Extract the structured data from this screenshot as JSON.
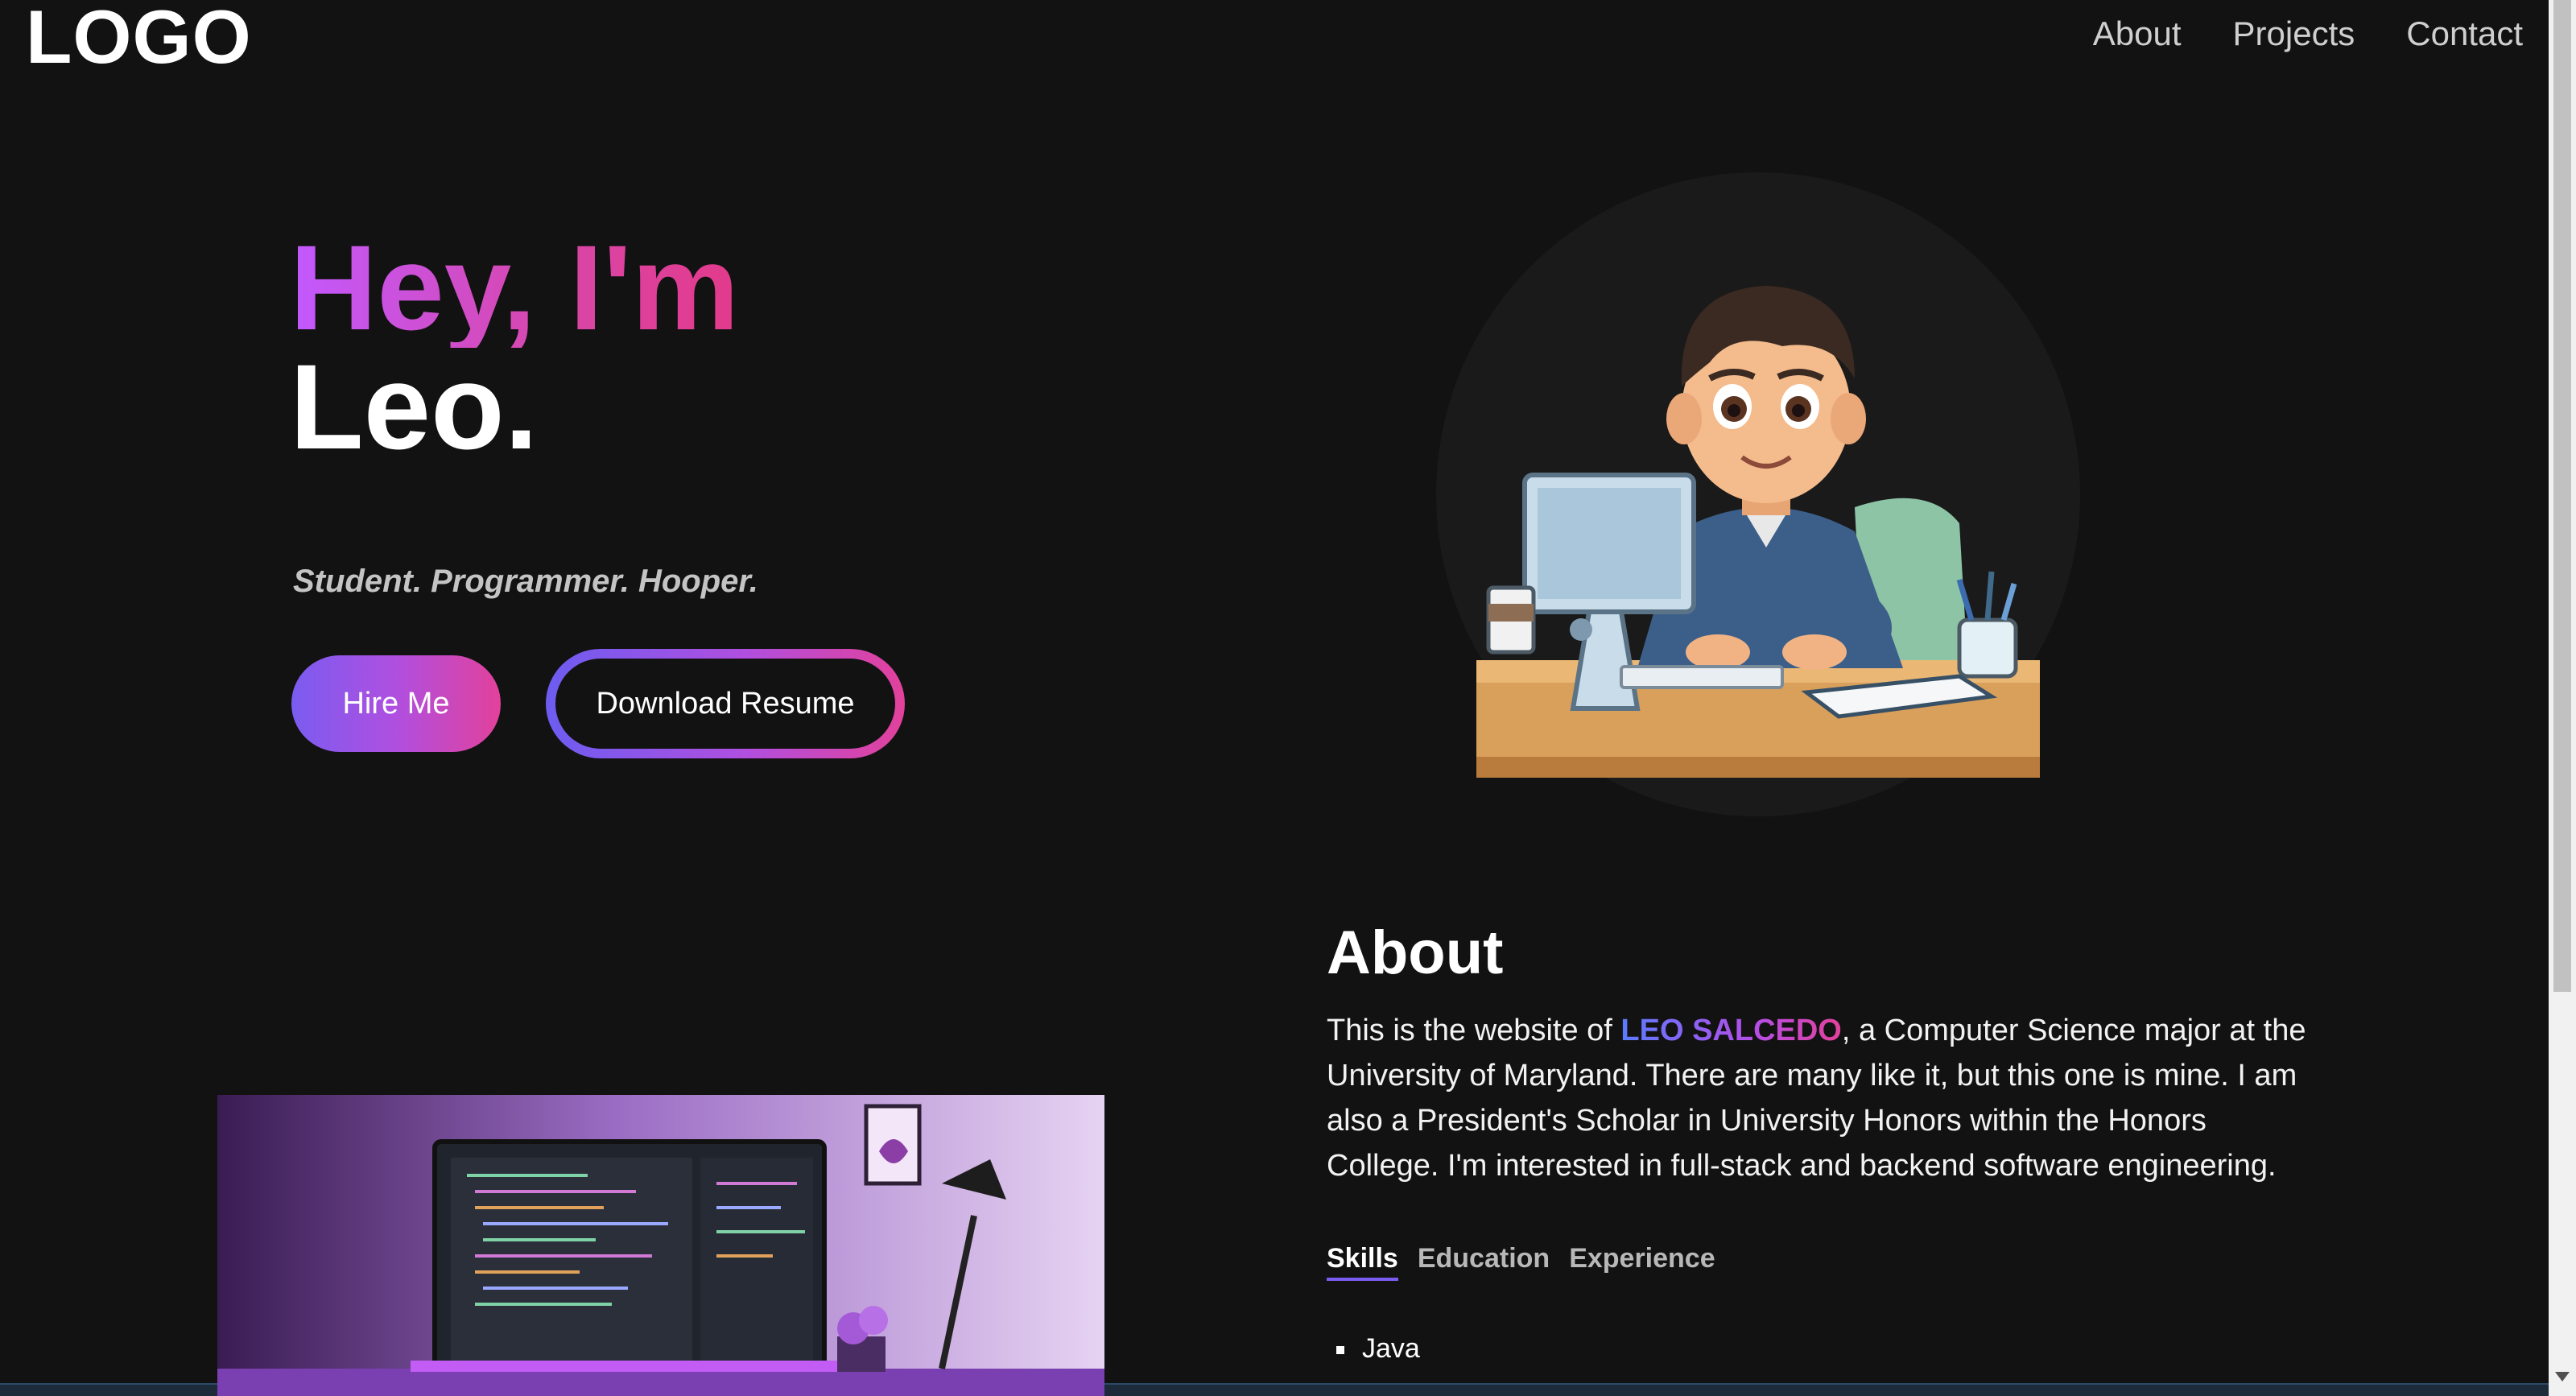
{
  "header": {
    "logo": "LOGO",
    "nav": [
      "About",
      "Projects",
      "Contact"
    ]
  },
  "hero": {
    "greeting": "Hey, I'm",
    "name": "Leo.",
    "tagline": "Student. Programmer. Hooper.",
    "hire_button": "Hire Me",
    "resume_button": "Download Resume"
  },
  "about": {
    "title": "About",
    "text_before": "This is the website of ",
    "highlight_name": "LEO SALCEDO",
    "text_after": ", a Computer Science major at the University of Maryland. There are many like it, but this one is mine. I am also a President's Scholar in University Honors within the Honors College. I'm interested in full-stack and backend software engineering.",
    "tabs": [
      {
        "label": "Skills",
        "active": true
      },
      {
        "label": "Education",
        "active": false
      },
      {
        "label": "Experience",
        "active": false
      }
    ],
    "skills": [
      "Java"
    ]
  },
  "colors": {
    "background": "#121212",
    "accent_purple": "#7b5cf0",
    "accent_pink": "#e2419b"
  }
}
